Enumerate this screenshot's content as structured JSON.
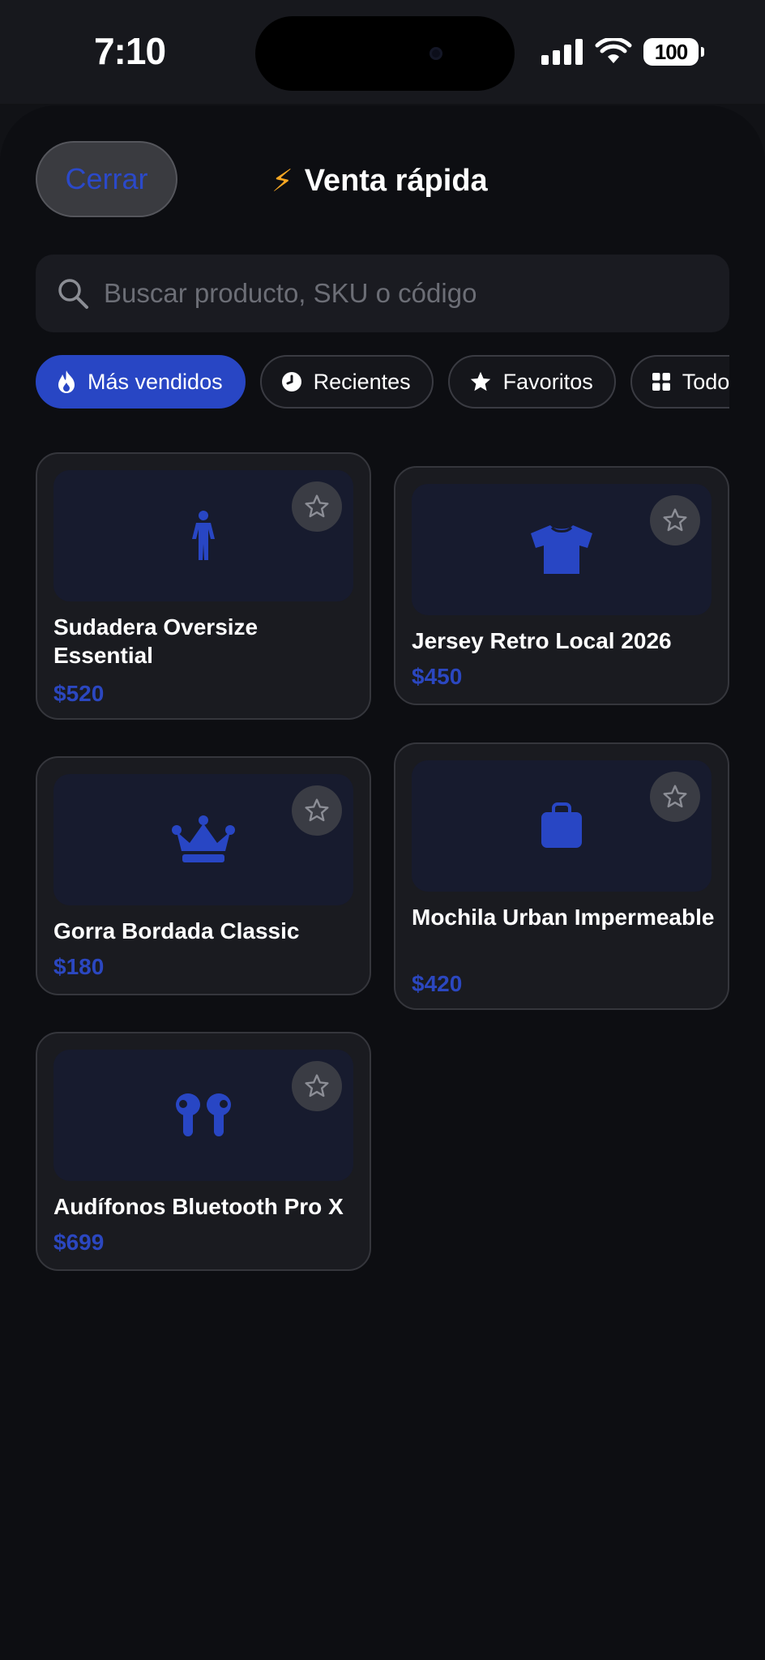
{
  "status_bar": {
    "time": "7:10",
    "battery": "100"
  },
  "header": {
    "close_label": "Cerrar",
    "title_emoji": "⚡",
    "title": "Venta rápida"
  },
  "search": {
    "placeholder": "Buscar producto, SKU o código"
  },
  "chips": [
    {
      "label": "Más vendidos",
      "icon": "fire-icon",
      "active": true
    },
    {
      "label": "Recientes",
      "icon": "clock-icon",
      "active": false
    },
    {
      "label": "Favoritos",
      "icon": "star-icon",
      "active": false
    },
    {
      "label": "Todos",
      "icon": "grid-icon",
      "active": false
    }
  ],
  "products": [
    {
      "name": "Sudadera Oversize Essential",
      "price": "$520",
      "icon": "person-icon"
    },
    {
      "name": "Jersey Retro Local 2026",
      "price": "$450",
      "icon": "tshirt-icon"
    },
    {
      "name": "Gorra Bordada Classic",
      "price": "$180",
      "icon": "crown-icon"
    },
    {
      "name": "Mochila Urban Impermeable",
      "price": "$420",
      "icon": "bag-icon"
    },
    {
      "name": "Audífonos Bluetooth Pro X",
      "price": "$699",
      "icon": "earbuds-icon"
    }
  ],
  "colors": {
    "accent": "#2846c4",
    "background": "#0d0e12",
    "card": "#1a1b20"
  }
}
